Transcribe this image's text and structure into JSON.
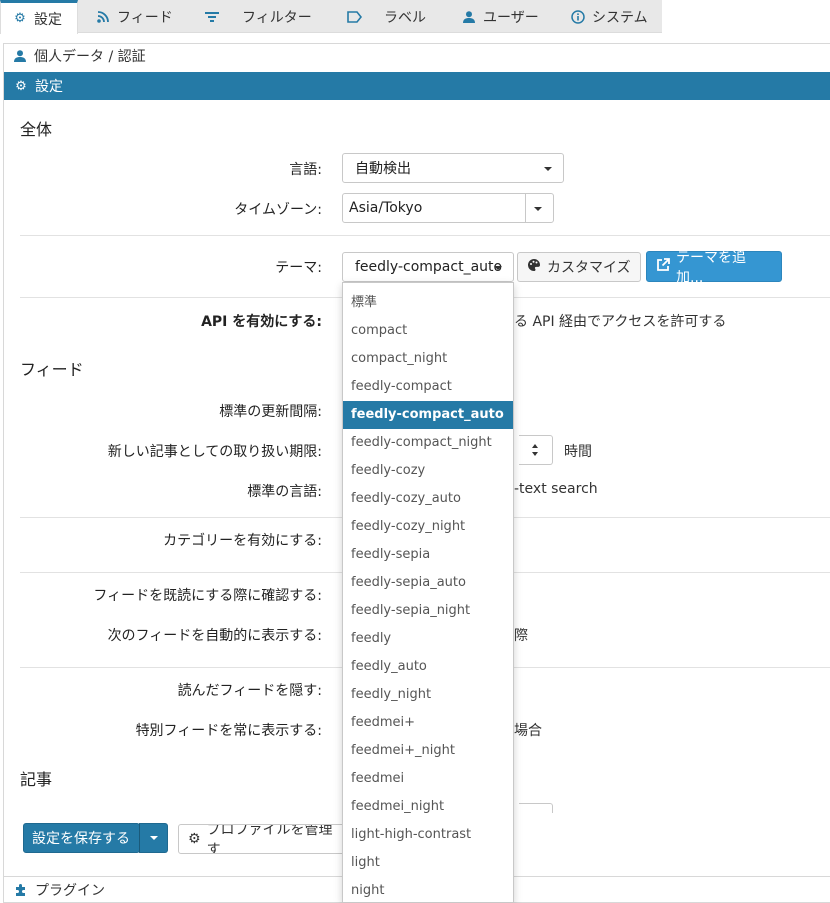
{
  "tabs": [
    {
      "label": "設定",
      "icon": "gear-icon"
    },
    {
      "label": "フィード",
      "icon": "rss-icon"
    },
    {
      "label": "フィルター",
      "icon": "filter-icon"
    },
    {
      "label": "ラベル",
      "icon": "label-icon"
    },
    {
      "label": "ユーザー",
      "icon": "user-icon"
    },
    {
      "label": "システム",
      "icon": "info-icon"
    }
  ],
  "breadcrumb": "個人データ / 認証",
  "settings_bar": "設定",
  "general": {
    "heading": "全体",
    "language_label": "言語:",
    "language_value": "自動検出",
    "timezone_label": "タイムゾーン:",
    "timezone_value": "Asia/Tokyo",
    "theme_label": "テーマ:",
    "theme_value": "feedly-compact_auto",
    "customize_button": "カスタマイズ",
    "add_theme_button": "テーマを追加...",
    "api_label": "API を有効にする:",
    "api_hint": "る API 経由でアクセスを許可する"
  },
  "feeds": {
    "heading": "フィード",
    "update_interval_label": "標準の更新間隔:",
    "fresh_limit_label": "新しい記事としての取り扱い期限:",
    "fresh_limit_unit": "時間",
    "language_label": "標準の言語:",
    "language_hint": "-text search",
    "categories_label": "カテゴリーを有効にする:",
    "confirm_mark_read_label": "フィードを既読にする際に確認する:",
    "auto_next_label": "次のフィードを自動的に表示する:",
    "auto_next_hint": "際",
    "hide_read_label": "読んだフィードを隠す:",
    "always_show_special_label": "特別フィードを常に表示する:",
    "always_show_special_hint": "場合"
  },
  "articles": {
    "heading": "記事"
  },
  "theme_options": [
    "標準",
    "compact",
    "compact_night",
    "feedly-compact",
    "feedly-compact_auto",
    "feedly-compact_night",
    "feedly-cozy",
    "feedly-cozy_auto",
    "feedly-cozy_night",
    "feedly-sepia",
    "feedly-sepia_auto",
    "feedly-sepia_night",
    "feedly",
    "feedly_auto",
    "feedly_night",
    "feedmei+",
    "feedmei+_night",
    "feedmei",
    "feedmei_night",
    "light-high-contrast",
    "light",
    "night"
  ],
  "theme_selected_index": 4,
  "actions": {
    "save_button": "設定を保存する",
    "manage_profiles_button": "プロファイルを管理す"
  },
  "footer": "プラグイン"
}
